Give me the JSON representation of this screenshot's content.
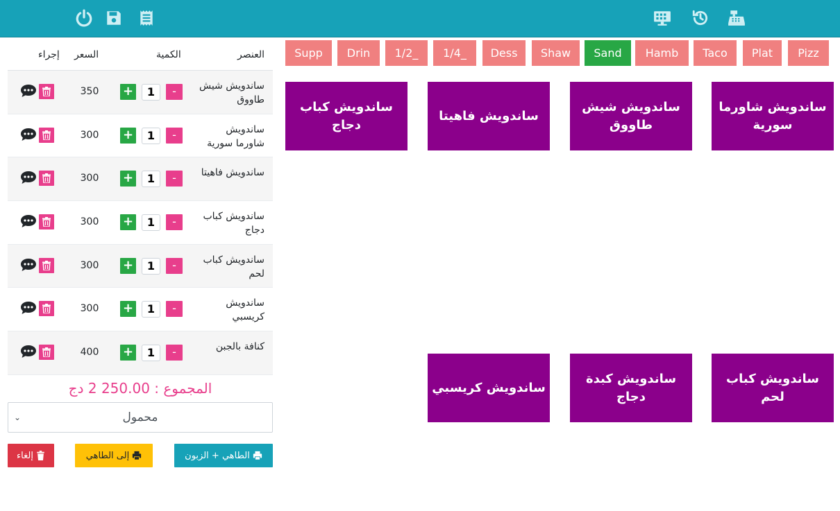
{
  "topbar": {
    "left_icons": [
      "power-icon",
      "save-icon",
      "receipt-icon"
    ],
    "right_icons": [
      "dashboard-icon",
      "history-icon",
      "cash-register-icon"
    ]
  },
  "order": {
    "headers": {
      "item": "العنصر",
      "qty": "الكمية",
      "price": "السعر",
      "action": "إجراء"
    },
    "rows": [
      {
        "name": "ساندويش شيش طاووق",
        "qty": "1",
        "price": "350"
      },
      {
        "name": "ساندويش شاورما سورية",
        "qty": "1",
        "price": "300"
      },
      {
        "name": "ساندويش فاهيتا",
        "qty": "1",
        "price": "300"
      },
      {
        "name": "ساندويش كباب دجاج",
        "qty": "1",
        "price": "300"
      },
      {
        "name": "ساندويش كباب لحم",
        "qty": "1",
        "price": "300"
      },
      {
        "name": "ساندويش كريسبي",
        "qty": "1",
        "price": "300"
      },
      {
        "name": "كنافة بالجبن",
        "qty": "1",
        "price": "400"
      }
    ],
    "plus_label": "+",
    "minus_label": "-",
    "total": "المجموع : 250.00 2 دج",
    "order_type": "محمول",
    "buttons": {
      "cancel": "إلغاء",
      "to_kitchen": "إلى الطاهي",
      "kitchen_and_client": "الطاهي + الزبون"
    }
  },
  "categories": [
    {
      "label": "Supp",
      "active": false
    },
    {
      "label": "Drin",
      "active": false
    },
    {
      "label": "1/2_",
      "active": false
    },
    {
      "label": "1/4_",
      "active": false
    },
    {
      "label": "Dess",
      "active": false
    },
    {
      "label": "Shaw",
      "active": false
    },
    {
      "label": "Sand",
      "active": true
    },
    {
      "label": "Hamb",
      "active": false
    },
    {
      "label": "Taco",
      "active": false
    },
    {
      "label": "Plat",
      "active": false
    },
    {
      "label": "Pizz",
      "active": false
    }
  ],
  "products": [
    "ساندويش كباب دجاج",
    "ساندويش فاهيتا",
    "ساندويش شيش طاووق",
    "ساندويش شاورما سورية",
    "ساندويش كريسبي",
    "ساندويش كبدة دجاج",
    "ساندويش كباب لحم"
  ],
  "colors": {
    "topbar": "#17a2b8",
    "category": "#f08080",
    "category_active": "#28a745",
    "tile": "#8b008b",
    "accent_pink": "#e83e8c"
  }
}
